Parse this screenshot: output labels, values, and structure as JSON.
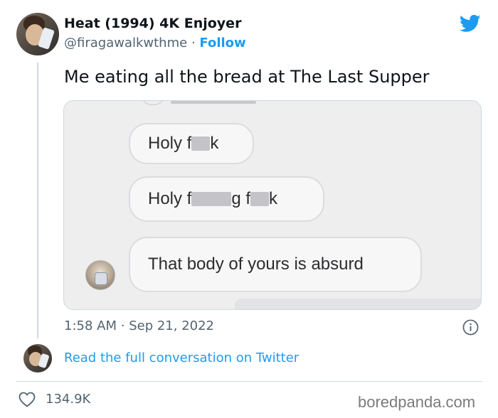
{
  "author": {
    "name": "Heat (1994) 4K Enjoyer",
    "handle": "@firagawalkwthme",
    "separator": "·",
    "follow_label": "Follow"
  },
  "tweet": {
    "text": "Me eating all the bread at The Last Supper",
    "time": "1:58 AM",
    "separator": "·",
    "date": "Sep 21, 2022"
  },
  "media": {
    "messages": [
      {
        "before": "Holy f",
        "after": "k"
      },
      {
        "before": "Holy f",
        "middle": "g f",
        "after": "k"
      },
      {
        "text": "That body of yours is absurd"
      }
    ]
  },
  "conversation": {
    "link_label": "Read the full conversation on Twitter"
  },
  "stats": {
    "likes": "134.9K"
  },
  "watermark": "boredpanda.com",
  "colors": {
    "accent": "#1d9bf0",
    "text": "#0f1419",
    "secondary_text": "#536471",
    "border": "#cfd9de"
  },
  "icons": [
    "twitter-bird-icon",
    "info-icon",
    "heart-icon"
  ]
}
